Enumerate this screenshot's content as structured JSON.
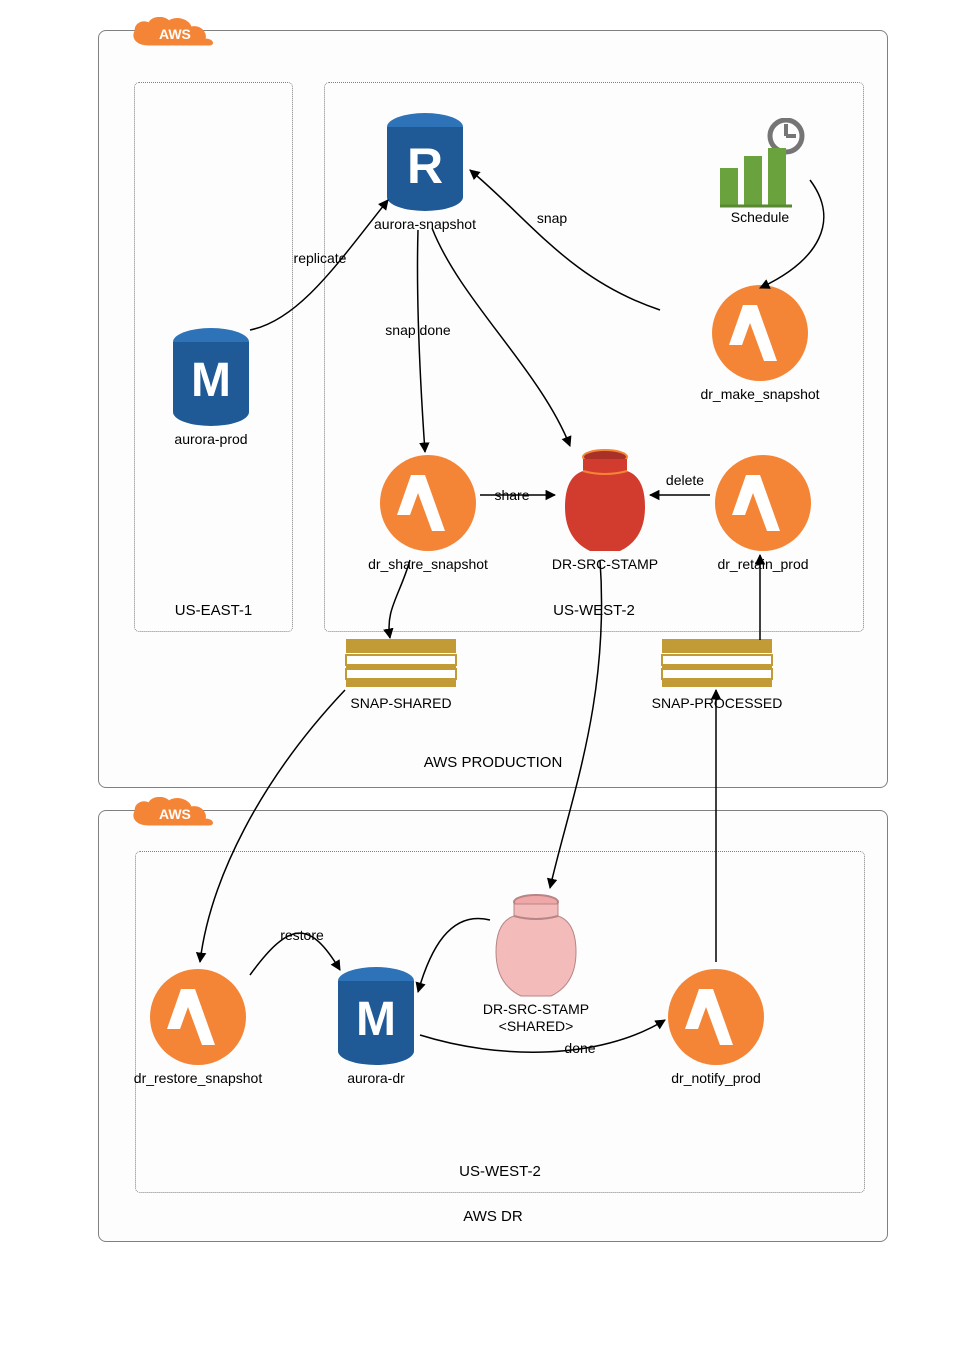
{
  "accounts": {
    "prod": "AWS PRODUCTION",
    "dr": "AWS DR"
  },
  "regions": {
    "east": "US-EAST-1",
    "west_prod": "US-WEST-2",
    "west_dr": "US-WEST-2"
  },
  "aws_tag": "AWS",
  "nodes": {
    "aurora_prod": "aurora-prod",
    "aurora_snapshot": "aurora-snapshot",
    "schedule": "Schedule",
    "dr_make_snapshot": "dr_make_snapshot",
    "dr_share_snapshot": "dr_share_snapshot",
    "dr_src_stamp": "DR-SRC-STAMP",
    "dr_retain_prod": "dr_retain_prod",
    "snap_shared": "SNAP-SHARED",
    "snap_processed": "SNAP-PROCESSED",
    "dr_restore_snapshot": "dr_restore_snapshot",
    "aurora_dr": "aurora-dr",
    "dr_src_stamp_shared_l1": "DR-SRC-STAMP",
    "dr_src_stamp_shared_l2": "<SHARED>",
    "dr_notify_prod": "dr_notify_prod"
  },
  "edges": {
    "replicate": "replicate",
    "snap": "snap",
    "snap_done": "snap done",
    "share": "share",
    "delete": "delete",
    "restore": "restore",
    "done": "done"
  },
  "colors": {
    "orange": "#F58536",
    "blue": "#2E73B8",
    "red": "#D13C2E",
    "pink": "#F4BBBB",
    "green": "#6AA33E",
    "gold": "#C29A36",
    "grey": "#757575"
  }
}
